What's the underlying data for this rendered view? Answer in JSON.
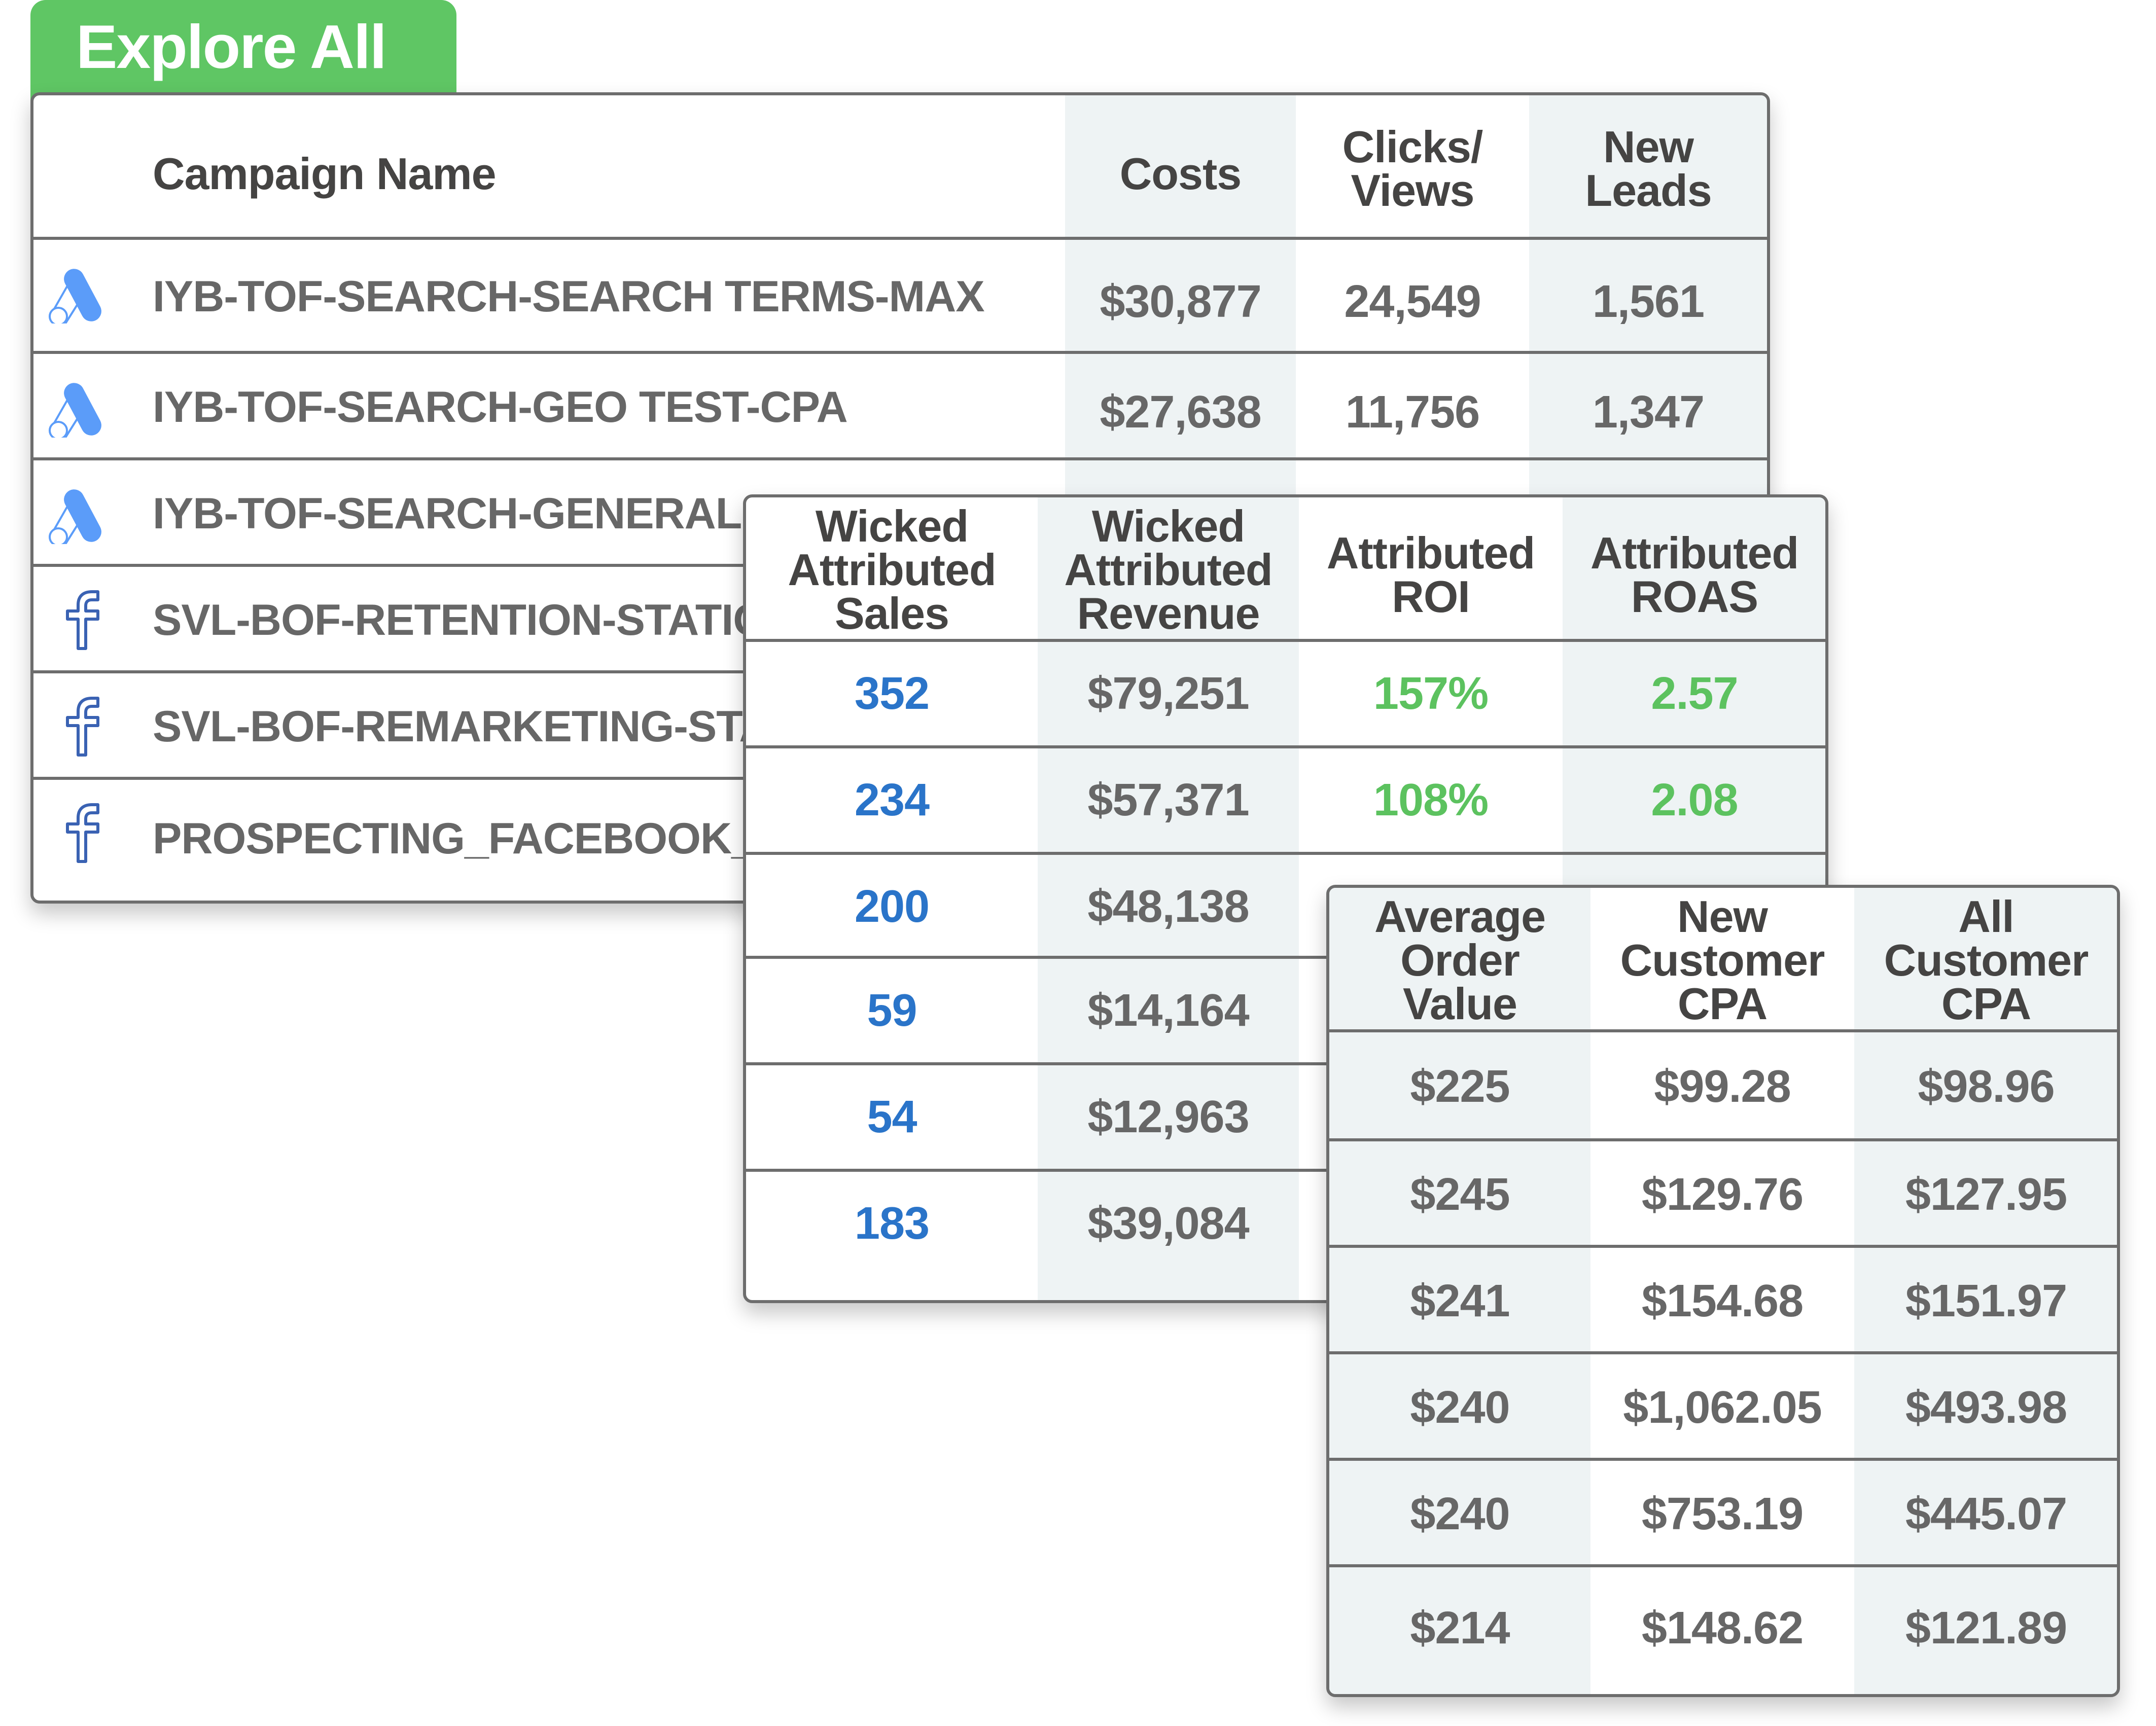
{
  "tab": {
    "label": "Explore All",
    "color": "#5fc664"
  },
  "campaigns_table": {
    "headers": {
      "name": "Campaign Name",
      "costs": "Costs",
      "clicks": "Clicks/\nViews",
      "leads": "New\nLeads"
    },
    "rows": [
      {
        "platform": "google-ads",
        "name": "IYB-TOF-SEARCH-SEARCH TERMS-MAX",
        "costs": "$30,877",
        "clicks": "24,549",
        "leads": "1,561"
      },
      {
        "platform": "google-ads",
        "name": "IYB-TOF-SEARCH-GEO TEST-CPA",
        "costs": "$27,638",
        "clicks": "11,756",
        "leads": "1,347"
      },
      {
        "platform": "google-ads",
        "name": "IYB-TOF-SEARCH-GENERAL-CPA",
        "costs": "",
        "clicks": "",
        "leads": ""
      },
      {
        "platform": "facebook",
        "name": "SVL-BOF-RETENTION-STATIC",
        "costs": "",
        "clicks": "",
        "leads": ""
      },
      {
        "platform": "facebook",
        "name": "SVL-BOF-REMARKETING-STATIC",
        "costs": "",
        "clicks": "",
        "leads": ""
      },
      {
        "platform": "facebook",
        "name": "PROSPECTING_FACEBOOK_BOGO",
        "costs": "",
        "clicks": "",
        "leads": ""
      }
    ]
  },
  "attribution_table": {
    "headers": {
      "sales": "Wicked\nAttributed\nSales",
      "revenue": "Wicked\nAttributed\nRevenue",
      "roi": "Attributed\nROI",
      "roas": "Attributed\nROAS"
    },
    "rows": [
      {
        "sales": "352",
        "revenue": "$79,251",
        "roi": "157%",
        "roas": "2.57"
      },
      {
        "sales": "234",
        "revenue": "$57,371",
        "roi": "108%",
        "roas": "2.08"
      },
      {
        "sales": "200",
        "revenue": "$48,138",
        "roi": "",
        "roas": ""
      },
      {
        "sales": "59",
        "revenue": "$14,164",
        "roi": "",
        "roas": ""
      },
      {
        "sales": "54",
        "revenue": "$12,963",
        "roi": "",
        "roas": ""
      },
      {
        "sales": "183",
        "revenue": "$39,084",
        "roi": "",
        "roas": ""
      }
    ],
    "colors": {
      "sales": "#2a74c9",
      "positive": "#5cc25f"
    }
  },
  "cpa_table": {
    "headers": {
      "aov": "Average\nOrder\nValue",
      "new_cpa": "New\nCustomer\nCPA",
      "all_cpa": "All\nCustomer\nCPA"
    },
    "rows": [
      {
        "aov": "$225",
        "new_cpa": "$99.28",
        "all_cpa": "$98.96"
      },
      {
        "aov": "$245",
        "new_cpa": "$129.76",
        "all_cpa": "$127.95"
      },
      {
        "aov": "$241",
        "new_cpa": "$154.68",
        "all_cpa": "$151.97"
      },
      {
        "aov": "$240",
        "new_cpa": "$1,062.05",
        "all_cpa": "$493.98"
      },
      {
        "aov": "$240",
        "new_cpa": "$753.19",
        "all_cpa": "$445.07"
      },
      {
        "aov": "$214",
        "new_cpa": "$148.62",
        "all_cpa": "$121.89"
      }
    ]
  }
}
